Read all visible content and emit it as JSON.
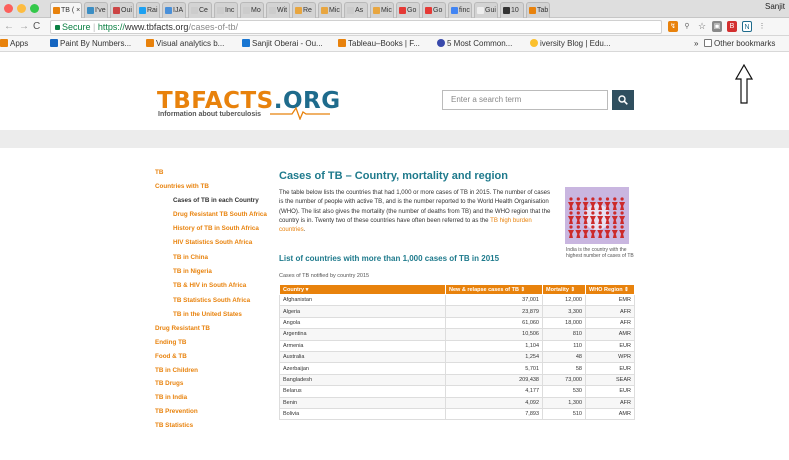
{
  "browser": {
    "tabs": [
      {
        "label": "TB ( ×",
        "fav": "#e8820c"
      },
      {
        "label": "I've",
        "fav": "#3b8ec4"
      },
      {
        "label": "Oui",
        "fav": "#c44"
      },
      {
        "label": "Rai",
        "fav": "#1da1f2"
      },
      {
        "label": "IJA",
        "fav": "#4a90d9"
      },
      {
        "label": "Ce",
        "fav": "#ccc"
      },
      {
        "label": "Inc",
        "fav": "#ccc"
      },
      {
        "label": "Mo",
        "fav": "#ccc"
      },
      {
        "label": "Wit",
        "fav": "#ccc"
      },
      {
        "label": "Re",
        "fav": "#e8a640"
      },
      {
        "label": "Mic",
        "fav": "#e8a640"
      },
      {
        "label": "As",
        "fav": "#ccc"
      },
      {
        "label": "Mic",
        "fav": "#e8a640"
      },
      {
        "label": "Go",
        "fav": "#e53935"
      },
      {
        "label": "Go",
        "fav": "#e53935"
      },
      {
        "label": "finc",
        "fav": "#4285f4"
      },
      {
        "label": "Gui",
        "fav": "#eee"
      },
      {
        "label": "10",
        "fav": "#333"
      },
      {
        "label": "Tab",
        "fav": "#e8820c"
      }
    ],
    "profile_name": "Sanjit",
    "secure_label": "Secure",
    "url_scheme": "https://",
    "url_domain": "www.tbfacts.org",
    "url_path": "/cases-of-tb/",
    "bookmarks": {
      "apps": "Apps",
      "items": [
        "Paint By Numbers...",
        "Visual analytics b...",
        "Sanjit Oberai - Ou...",
        "Tableau–Books | F...",
        "5 Most Common...",
        "iversity Blog | Edu..."
      ],
      "overflow": "»",
      "other": "Other bookmarks"
    }
  },
  "site": {
    "logo_tb": "TBFACTS",
    "logo_org": ".ORG",
    "tagline": "Information about tuberculosis",
    "search_placeholder": "Enter a search term",
    "colors": {
      "orange": "#e8820c",
      "teal": "#1e7a8c",
      "dark": "#2f4f5f"
    }
  },
  "sidebar": {
    "items": [
      {
        "label": "TB",
        "level": 0
      },
      {
        "label": "Countries with TB",
        "level": 0
      },
      {
        "label": "Cases of TB in each Country",
        "level": 1,
        "current": true
      },
      {
        "label": "Drug Resistant TB South Africa",
        "level": 1
      },
      {
        "label": "History of TB in South Africa",
        "level": 1
      },
      {
        "label": "HIV Statistics South Africa",
        "level": 1
      },
      {
        "label": "TB in China",
        "level": 1
      },
      {
        "label": "TB in Nigeria",
        "level": 1
      },
      {
        "label": "TB & HIV in South Africa",
        "level": 1
      },
      {
        "label": "TB Statistics South Africa",
        "level": 1
      },
      {
        "label": "TB in the United States",
        "level": 1
      },
      {
        "label": "Drug Resistant TB",
        "level": 0
      },
      {
        "label": "Ending TB",
        "level": 0
      },
      {
        "label": "Food & TB",
        "level": 0
      },
      {
        "label": "TB in Children",
        "level": 0
      },
      {
        "label": "TB Drugs",
        "level": 0
      },
      {
        "label": "TB in India",
        "level": 0
      },
      {
        "label": "TB Prevention",
        "level": 0
      },
      {
        "label": "TB Statistics",
        "level": 0
      }
    ]
  },
  "main": {
    "title": "Cases of TB – Country, mortality and region",
    "intro_1": "The table below lists the countries that had 1,000 or more cases of TB in 2015. The number of cases is the number of people with active TB, and is the number reported to the World Health Organisation (WHO). The list also gives the mortality (the number of deaths from TB) and the WHO region that the country is in. Twenty two of these countries have often been referred to as the ",
    "intro_link": "TB high burden countries",
    "intro_2": ".",
    "image_caption": "India is the country with the highest number of cases of TB",
    "subtitle": "List of countries with more than 1,000 cases of TB in 2015",
    "table_caption": "Cases of TB notified by country 2015",
    "table": {
      "headers": [
        "Country ▾",
        "New & relapse cases of TB ⇕",
        "Mortality ⇕",
        "WHO Region ⇕"
      ],
      "rows": [
        [
          "Afghanistan",
          "37,001",
          "12,000",
          "EMR"
        ],
        [
          "Algeria",
          "23,879",
          "3,300",
          "AFR"
        ],
        [
          "Angola",
          "61,060",
          "18,000",
          "AFR"
        ],
        [
          "Argentina",
          "10,506",
          "810",
          "AMR"
        ],
        [
          "Armenia",
          "1,104",
          "110",
          "EUR"
        ],
        [
          "Australia",
          "1,254",
          "48",
          "WPR"
        ],
        [
          "Azerbaijan",
          "5,701",
          "58",
          "EUR"
        ],
        [
          "Bangladesh",
          "209,438",
          "73,000",
          "SEAR"
        ],
        [
          "Belarus",
          "4,177",
          "530",
          "EUR"
        ],
        [
          "Benin",
          "4,092",
          "1,300",
          "AFR"
        ],
        [
          "Bolivia",
          "7,893",
          "510",
          "AMR"
        ]
      ]
    }
  }
}
